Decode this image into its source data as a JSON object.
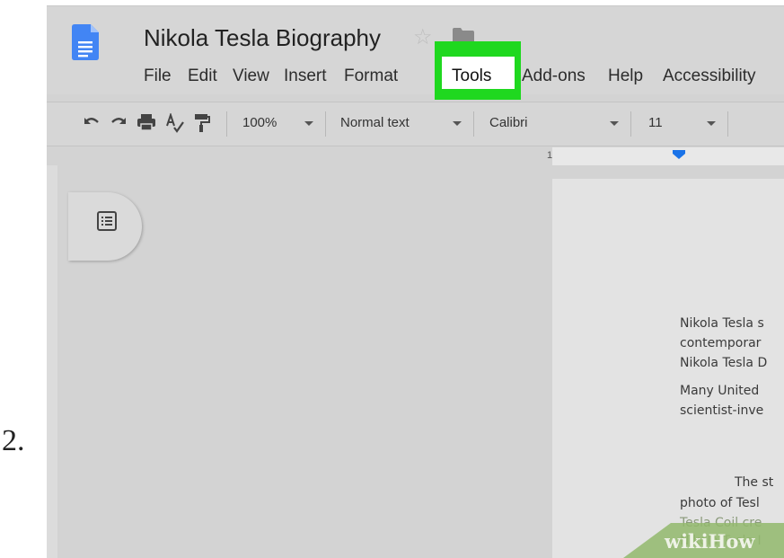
{
  "step": {
    "number": "2."
  },
  "document": {
    "title": "Nikola Tesla Biography"
  },
  "menu": [
    {
      "label": "File"
    },
    {
      "label": "Edit"
    },
    {
      "label": "View"
    },
    {
      "label": "Insert"
    },
    {
      "label": "Format"
    },
    {
      "label": "Tools"
    },
    {
      "label": "Add-ons"
    },
    {
      "label": "Help"
    },
    {
      "label": "Accessibility"
    }
  ],
  "toolbar": {
    "zoom": "100%",
    "style": "Normal text",
    "font": "Calibri",
    "font_size": "11"
  },
  "ruler": {
    "mark": "1"
  },
  "body": {
    "lines": [
      "Nikola Tesla s",
      "contemporar",
      "Nikola Tesla D",
      "Many United",
      "scientist-inve",
      "The st",
      "photo of Tesl",
      "Tesla Coil cre",
      "Nikola Tesla I"
    ]
  },
  "watermark": {
    "text": "wikiHow"
  },
  "colors": {
    "highlight": "#1fd81f",
    "docs_blue": "#4285f4",
    "ruler_marker": "#1a73e8"
  }
}
